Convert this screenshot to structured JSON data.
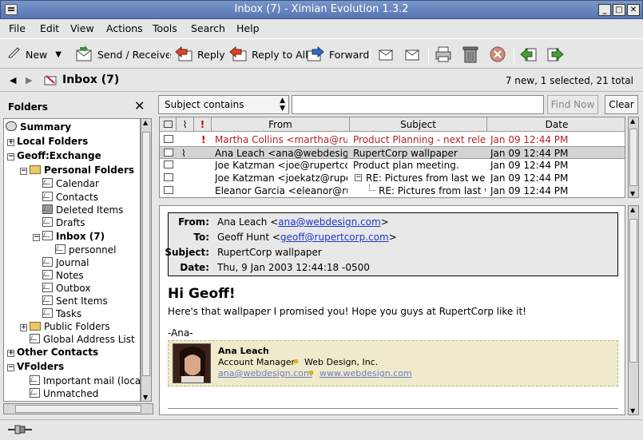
{
  "window": {
    "title": "Inbox (7) - Ximian Evolution 1.3.2"
  },
  "menubar": {
    "items": [
      {
        "label": "File"
      },
      {
        "label": "Edit"
      },
      {
        "label": "View"
      },
      {
        "label": "Actions"
      },
      {
        "label": "Tools"
      },
      {
        "label": "Search"
      },
      {
        "label": "Help"
      }
    ]
  },
  "toolbar": {
    "new_label": "New",
    "send_receive_label": "Send / Receive",
    "reply_label": "Reply",
    "reply_all_label": "Reply to All",
    "forward_label": "Forward"
  },
  "location": {
    "folder_title": "Inbox (7)",
    "status": "7 new, 1 selected, 21 total"
  },
  "sidebar": {
    "header": "Folders",
    "items": [
      {
        "label": "Summary"
      },
      {
        "label": "Local Folders"
      },
      {
        "label": "Geoff:Exchange"
      },
      {
        "label": "Personal Folders"
      },
      {
        "label": "Calendar"
      },
      {
        "label": "Contacts"
      },
      {
        "label": "Deleted Items"
      },
      {
        "label": "Drafts"
      },
      {
        "label": "Inbox (7)"
      },
      {
        "label": "personnel"
      },
      {
        "label": "Journal"
      },
      {
        "label": "Notes"
      },
      {
        "label": "Outbox"
      },
      {
        "label": "Sent Items"
      },
      {
        "label": "Tasks"
      },
      {
        "label": "Public Folders"
      },
      {
        "label": "Global Address List"
      },
      {
        "label": "Other Contacts"
      },
      {
        "label": "VFolders"
      },
      {
        "label": "Important mail (local)"
      },
      {
        "label": "Unmatched"
      }
    ]
  },
  "search": {
    "criteria": "Subject contains",
    "value": "",
    "find_now_label": "Find Now",
    "clear_label": "Clear"
  },
  "message_list": {
    "columns": [
      {
        "label": "From"
      },
      {
        "label": "Subject"
      },
      {
        "label": "Date"
      }
    ],
    "rows": [
      {
        "from": "Martha Collins <martha@rupe",
        "subject": "Product Planning - next releas",
        "date": "Jan 09 12:44 PM",
        "important": "!"
      },
      {
        "from": "Ana Leach <ana@webdesign.",
        "subject": "RupertCorp wallpaper",
        "date": "Jan 09 12:44 PM",
        "important": ""
      },
      {
        "from": "Joe Katzman <joe@rupertcorp",
        "subject": "Product plan meeting.",
        "date": "Jan 09 12:44 PM",
        "important": ""
      },
      {
        "from": "Joe Katzman <joekatz@rupert",
        "subject": "RE: Pictures from last week",
        "date": "Jan 09 12:44 PM",
        "important": ""
      },
      {
        "from": "Eleanor Garcia <eleanor@rup",
        "subject": "RE: Pictures from last we",
        "date": "Jan 09 12:44 PM",
        "important": ""
      }
    ]
  },
  "preview": {
    "headers": {
      "from_label": "From:",
      "from_name": "Ana Leach <",
      "from_email": "ana@webdesign.com",
      "from_close": ">",
      "to_label": "To:",
      "to_name": "Geoff Hunt <",
      "to_email": "geoff@rupertcorp.com",
      "to_close": ">",
      "subject_label": "Subject:",
      "subject_value": "RupertCorp wallpaper",
      "date_label": "Date:",
      "date_value": "Thu, 9 Jan 2003 12:44:18 -0500"
    },
    "greeting": "Hi Geoff!",
    "body": "Here's that wallpaper I promised you! Hope you guys at RupertCorp like it!",
    "signoff": "-Ana-",
    "signature": {
      "name": "Ana Leach",
      "title": "Account Manager",
      "company": "Web Design, Inc.",
      "email": "ana@webdesign.com",
      "website": "www.webdesign.com"
    }
  },
  "colors": {
    "titlebar": "#6684bd",
    "important_row": "#b22222",
    "selected_row": "#d4d4d4",
    "link": "#1a37cc"
  }
}
